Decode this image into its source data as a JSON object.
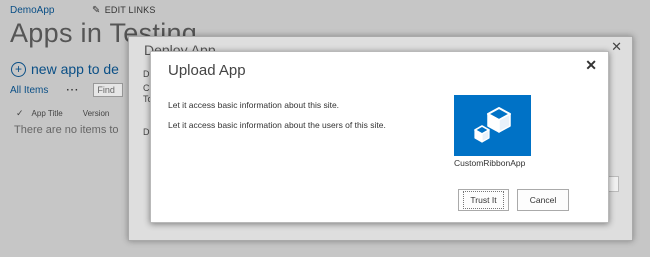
{
  "background": {
    "site_name": "DemoApp",
    "edit_links_label": "EDIT LINKS",
    "page_title": "Apps in Testing",
    "new_app_label": "new app to de",
    "all_items_label": "All Items",
    "more_label": "···",
    "find_placeholder": "Find",
    "columns": [
      "App Title",
      "Version"
    ],
    "empty_message": "There are no items to"
  },
  "deploy_dialog": {
    "title": "Deploy App",
    "fragments": [
      "D",
      "C",
      "To",
      "D"
    ]
  },
  "upload_dialog": {
    "title": "Upload App",
    "permissions": [
      "Let it access basic information about this site.",
      "Let it access basic information about the users of this site."
    ],
    "app_name": "CustomRibbonApp",
    "trust_label": "Trust It",
    "cancel_label": "Cancel"
  },
  "colors": {
    "accent": "#0072c6",
    "link": "#0a4f86"
  },
  "icons": {
    "close": "close-icon",
    "edit": "pencil-icon",
    "add": "plus-circle-icon",
    "app": "app-cubes-icon"
  }
}
